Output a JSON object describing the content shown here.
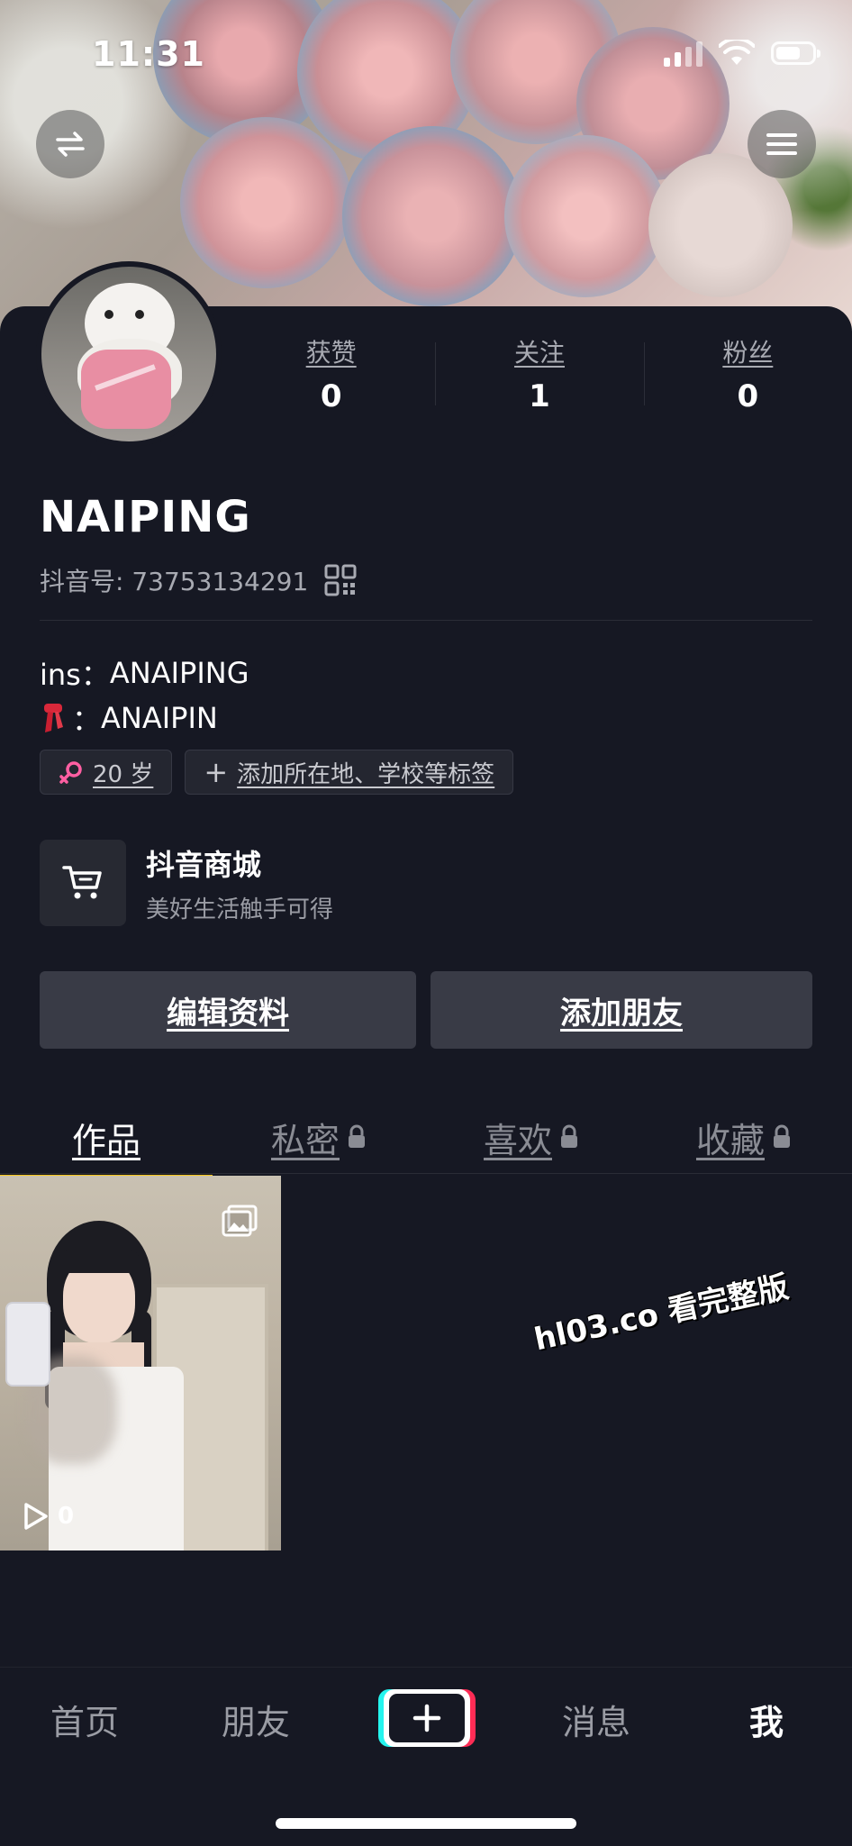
{
  "status_bar": {
    "time": "11:31"
  },
  "header": {
    "switch_icon": "swap-arrows-icon",
    "menu_icon": "hamburger-menu-icon"
  },
  "profile": {
    "name": "NAIPING",
    "douyin_id": "抖音号: 73753134291",
    "stats": [
      {
        "label": "获赞",
        "value": "0"
      },
      {
        "label": "关注",
        "value": "1"
      },
      {
        "label": "粉丝",
        "value": "0"
      }
    ],
    "bio": [
      {
        "prefix": "ins：",
        "text": "ANAIPING"
      },
      {
        "prefix": "：",
        "text": "ANAIPIN",
        "icon": "red-scarf-icon"
      }
    ],
    "tags": {
      "age": "20 岁",
      "add_tag": "添加所在地、学校等标签"
    }
  },
  "shop": {
    "title": "抖音商城",
    "subtitle": "美好生活触手可得"
  },
  "actions": {
    "edit_profile": "编辑资料",
    "add_friend": "添加朋友"
  },
  "tabs": [
    {
      "label": "作品",
      "active": true,
      "locked": false
    },
    {
      "label": "私密",
      "active": false,
      "locked": true
    },
    {
      "label": "喜欢",
      "active": false,
      "locked": true
    },
    {
      "label": "收藏",
      "active": false,
      "locked": true
    }
  ],
  "videos": [
    {
      "play_count": "0"
    }
  ],
  "watermark": "hl03.co 看完整版",
  "bottom_nav": [
    {
      "label": "首页"
    },
    {
      "label": "朋友"
    },
    {
      "label": "消息"
    },
    {
      "label": "我",
      "active": true
    }
  ],
  "colors": {
    "background": "#161823",
    "accent_underline": "#f5c518",
    "button_bg": "#393b46"
  }
}
